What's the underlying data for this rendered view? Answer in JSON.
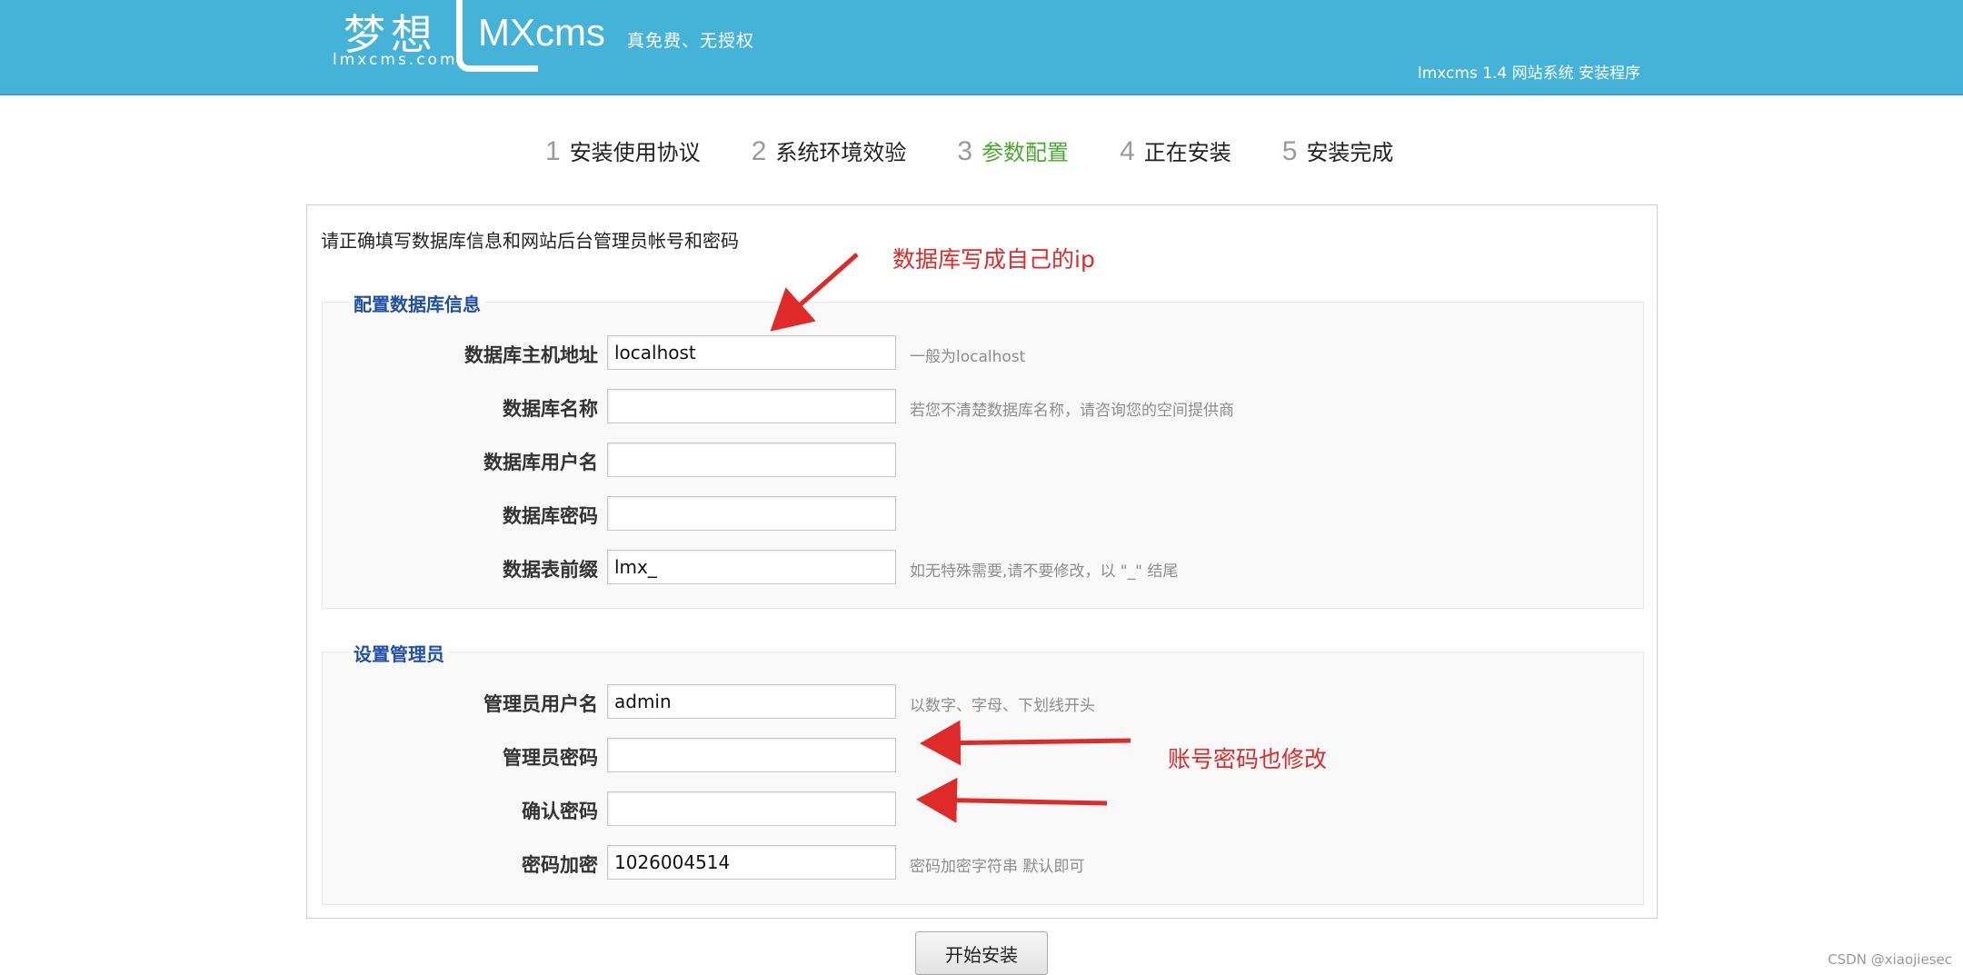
{
  "header": {
    "logo_cn": "梦想",
    "logo_domain": "lmxcms.com",
    "logo_mx": "MXcms",
    "slogan": "真免费、无授权",
    "installer_title": "lmxcms 1.4 网站系统 安装程序",
    "bg_color": "#45b3d8"
  },
  "steps": [
    {
      "num": "1",
      "label": "安装使用协议"
    },
    {
      "num": "2",
      "label": "系统环境效验"
    },
    {
      "num": "3",
      "label": "参数配置",
      "active": true
    },
    {
      "num": "4",
      "label": "正在安装"
    },
    {
      "num": "5",
      "label": "安装完成"
    }
  ],
  "intro": "请正确填写数据库信息和网站后台管理员帐号和密码",
  "db_section": {
    "title": "配置数据库信息",
    "rows": [
      {
        "label": "数据库主机地址",
        "value": "localhost",
        "hint": "一般为localhost"
      },
      {
        "label": "数据库名称",
        "value": "",
        "hint": "若您不清楚数据库名称，请咨询您的空间提供商"
      },
      {
        "label": "数据库用户名",
        "value": "",
        "hint": ""
      },
      {
        "label": "数据库密码",
        "value": "",
        "hint": ""
      },
      {
        "label": "数据表前缀",
        "value": "lmx_",
        "hint": "如无特殊需要,请不要修改，以 \"_\" 结尾"
      }
    ]
  },
  "admin_section": {
    "title": "设置管理员",
    "rows": [
      {
        "label": "管理员用户名",
        "value": "admin",
        "hint": "以数字、字母、下划线开头"
      },
      {
        "label": "管理员密码",
        "value": "",
        "hint": ""
      },
      {
        "label": "确认密码",
        "value": "",
        "hint": ""
      },
      {
        "label": "密码加密",
        "value": "1026004514",
        "hint": "密码加密字符串 默认即可"
      }
    ]
  },
  "annotations": {
    "db_note": "数据库写成自己的ip",
    "account_note": "账号密码也修改",
    "color": "#e02a2a"
  },
  "install_button": "开始安装",
  "watermark": "CSDN @xiaojiesec"
}
